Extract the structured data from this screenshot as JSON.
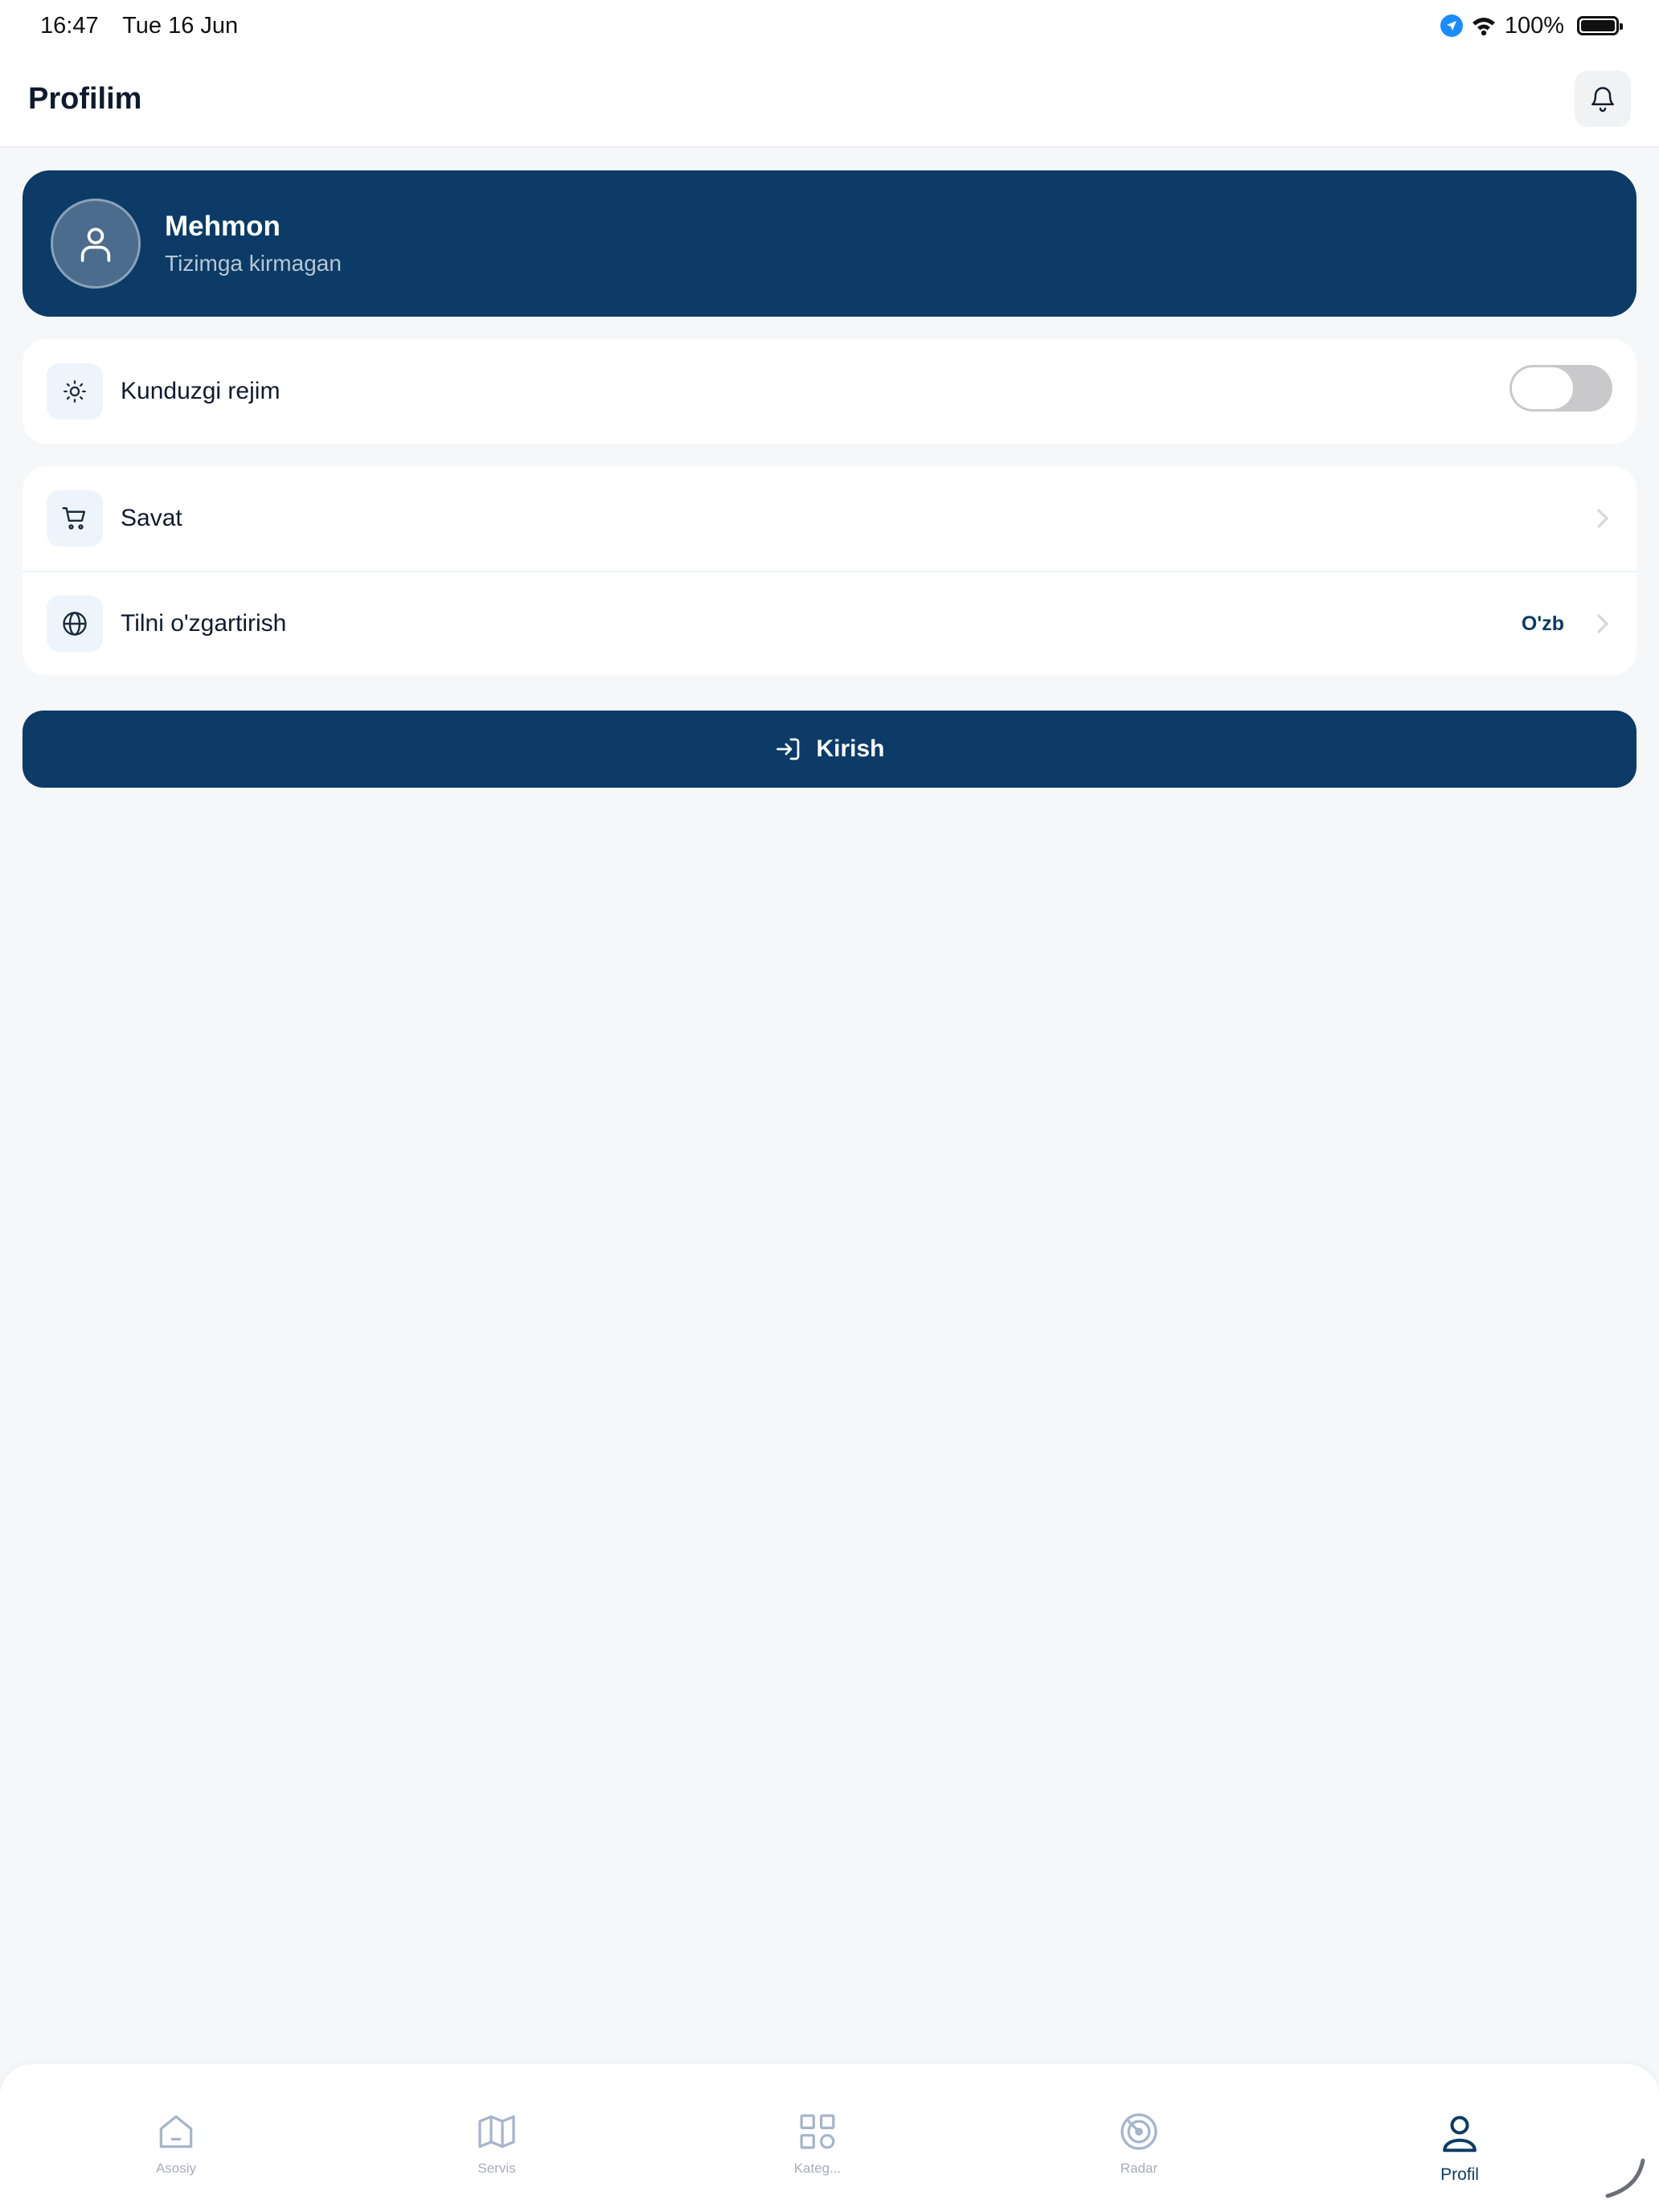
{
  "status_bar": {
    "time": "16:47",
    "date": "Tue 16 Jun",
    "battery": "100%"
  },
  "header": {
    "title": "Profilim"
  },
  "profile": {
    "name": "Mehmon",
    "subtitle": "Tizimga kirmagan"
  },
  "settings": {
    "day_mode_label": "Kunduzgi rejim",
    "day_mode_enabled": false
  },
  "menu": {
    "cart_label": "Savat",
    "language_label": "Tilni o'zgartirish",
    "language_value": "O'zb"
  },
  "login": {
    "label": "Kirish"
  },
  "tabbar": {
    "tabs": [
      {
        "label": "Asosiy",
        "icon": "home-icon"
      },
      {
        "label": "Servis",
        "icon": "map-icon"
      },
      {
        "label": "Kateg...",
        "icon": "grid-icon"
      },
      {
        "label": "Radar",
        "icon": "radar-icon"
      },
      {
        "label": "Profil",
        "icon": "user-icon",
        "active": true
      }
    ]
  },
  "colors": {
    "primary": "#0b3b66",
    "background": "#f6f7f9",
    "inactive_tab": "#a6adbb"
  }
}
